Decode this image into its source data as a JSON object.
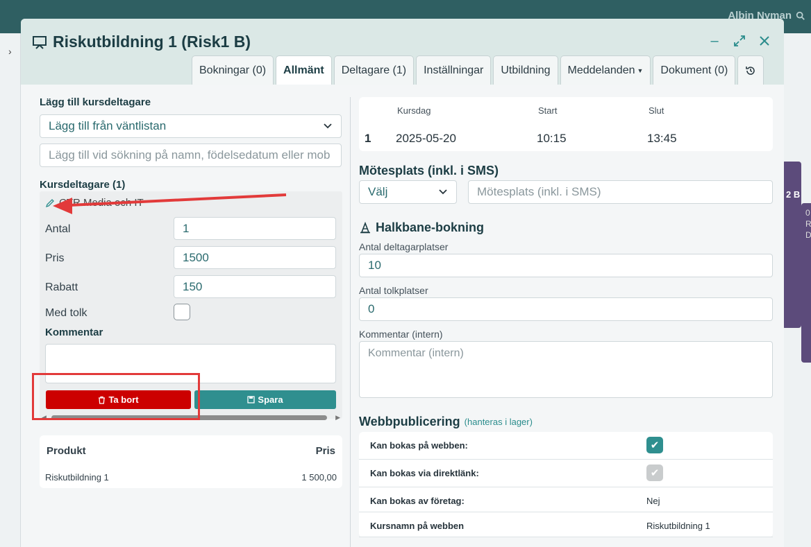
{
  "background": {
    "user_name": "Albin Nyman",
    "event_label_1": "2 B",
    "event_label_2": "0 R D"
  },
  "modal": {
    "title": "Riskutbildning 1 (Risk1 B)",
    "tabs": [
      {
        "label": "Bokningar (0)"
      },
      {
        "label": "Allmänt"
      },
      {
        "label": "Deltagare (1)"
      },
      {
        "label": "Inställningar"
      },
      {
        "label": "Utbildning"
      },
      {
        "label": "Meddelanden"
      },
      {
        "label": "Dokument (0)"
      }
    ]
  },
  "left": {
    "add_heading": "Lägg till kursdeltagare",
    "waitlist_select": "Lägg till från väntlistan",
    "search_placeholder": "Lägg till vid sökning på namn, födelsedatum eller mob",
    "participants_heading": "Kursdeltagare (1)",
    "participant": {
      "name": "CTR Media och IT",
      "antal_label": "Antal",
      "antal_value": "1",
      "pris_label": "Pris",
      "pris_value": "1500",
      "rabatt_label": "Rabatt",
      "rabatt_value": "150",
      "tolk_label": "Med tolk",
      "kommentar_label": "Kommentar",
      "delete_label": "Ta bort",
      "save_label": "Spara"
    },
    "products": {
      "col_product": "Produkt",
      "col_price": "Pris",
      "rows": [
        {
          "product": "Riskutbildning 1",
          "price": "1 500,00"
        }
      ]
    }
  },
  "right": {
    "schedule": {
      "col_day": "Kursdag",
      "col_start": "Start",
      "col_end": "Slut",
      "rows": [
        {
          "index": "1",
          "day": "2025-05-20",
          "start": "10:15",
          "end": "13:45"
        }
      ]
    },
    "meeting_heading": "Mötesplats (inkl. i SMS)",
    "meeting_select": "Välj",
    "meeting_placeholder": "Mötesplats (inkl. i SMS)",
    "halkbane_heading": "Halkbane-bokning",
    "participant_spots_label": "Antal deltagarplatser",
    "participant_spots_value": "10",
    "interpreter_spots_label": "Antal tolkplatser",
    "interpreter_spots_value": "0",
    "internal_comment_label": "Kommentar (intern)",
    "internal_comment_placeholder": "Kommentar (intern)",
    "web_heading": "Webbpublicering",
    "web_sub": "(hanteras i lager)",
    "web_rows": [
      {
        "label": "Kan bokas på webben:",
        "checked": true
      },
      {
        "label": "Kan bokas via direktlänk:",
        "checked": true
      },
      {
        "label": "Kan bokas av företag:",
        "value": "Nej"
      },
      {
        "label": "Kursnamn på webben",
        "value": "Riskutbildning 1"
      }
    ]
  },
  "colors": {
    "accent": "#2f8f8f",
    "danger": "#cc0000",
    "annotation": "#e23a3a",
    "header_bg": "#dbe8e6"
  }
}
